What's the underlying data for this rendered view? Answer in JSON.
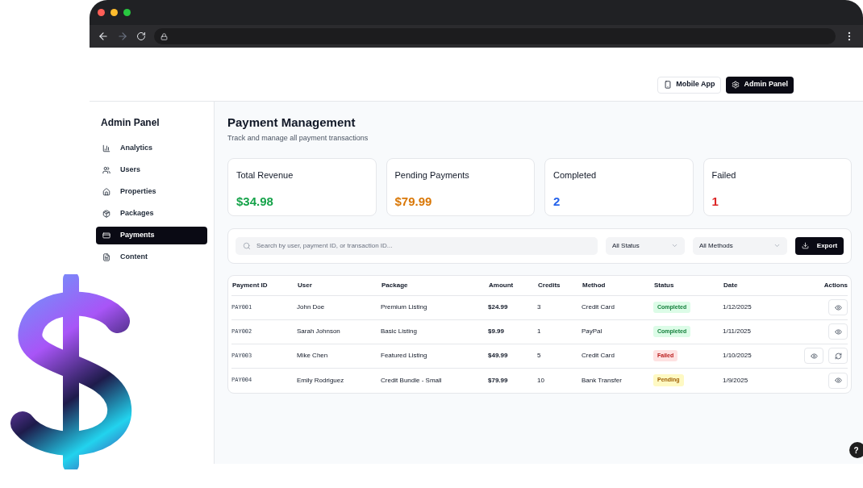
{
  "header": {
    "buttons": [
      {
        "label": "Mobile App",
        "selected": false
      },
      {
        "label": "Admin Panel",
        "selected": true
      }
    ]
  },
  "sidebar": {
    "title": "Admin Panel",
    "items": [
      {
        "label": "Analytics",
        "selected": false
      },
      {
        "label": "Users",
        "selected": false
      },
      {
        "label": "Properties",
        "selected": false
      },
      {
        "label": "Packages",
        "selected": false
      },
      {
        "label": "Payments",
        "selected": true
      },
      {
        "label": "Content",
        "selected": false
      }
    ]
  },
  "page": {
    "title": "Payment Management",
    "subtitle": "Track and manage all payment transactions"
  },
  "stats": [
    {
      "label": "Total Revenue",
      "value": "$34.98",
      "color": "#16a34a"
    },
    {
      "label": "Pending Payments",
      "value": "$79.99",
      "color": "#d97706"
    },
    {
      "label": "Completed",
      "value": "2",
      "color": "#2563eb"
    },
    {
      "label": "Failed",
      "value": "1",
      "color": "#dc2626"
    }
  ],
  "filters": {
    "search": {
      "placeholder": "Search by user, payment ID, or transaction ID..."
    },
    "status": "All Status",
    "method": "All Methods",
    "export": "Export"
  },
  "table": {
    "columns": [
      "Payment ID",
      "User",
      "Package",
      "Amount",
      "Credits",
      "Method",
      "Status",
      "Date",
      "Actions"
    ],
    "rows": [
      {
        "id": "PAY001",
        "user": "John Doe",
        "package": "Premium Listing",
        "amount": "$24.99",
        "credits": "3",
        "method": "Credit Card",
        "status": {
          "text": "Completed",
          "kind": "completed"
        },
        "date": "1/12/2025",
        "actions": [
          {
            "kind": "view"
          }
        ]
      },
      {
        "id": "PAY002",
        "user": "Sarah Johnson",
        "package": "Basic Listing",
        "amount": "$9.99",
        "credits": "1",
        "method": "PayPal",
        "status": {
          "text": "Completed",
          "kind": "completed"
        },
        "date": "1/11/2025",
        "actions": [
          {
            "kind": "view"
          }
        ]
      },
      {
        "id": "PAY003",
        "user": "Mike Chen",
        "package": "Featured Listing",
        "amount": "$49.99",
        "credits": "5",
        "method": "Credit Card",
        "status": {
          "text": "Failed",
          "kind": "failed"
        },
        "date": "1/10/2025",
        "actions": [
          {
            "kind": "view"
          },
          {
            "kind": "retry"
          }
        ]
      },
      {
        "id": "PAY004",
        "user": "Emily Rodriguez",
        "package": "Credit Bundle - Small",
        "amount": "$79.99",
        "credits": "10",
        "method": "Bank Transfer",
        "status": {
          "text": "Pending",
          "kind": "pending"
        },
        "date": "1/9/2025",
        "actions": [
          {
            "kind": "view"
          }
        ]
      }
    ]
  },
  "help": {
    "label": "?"
  }
}
